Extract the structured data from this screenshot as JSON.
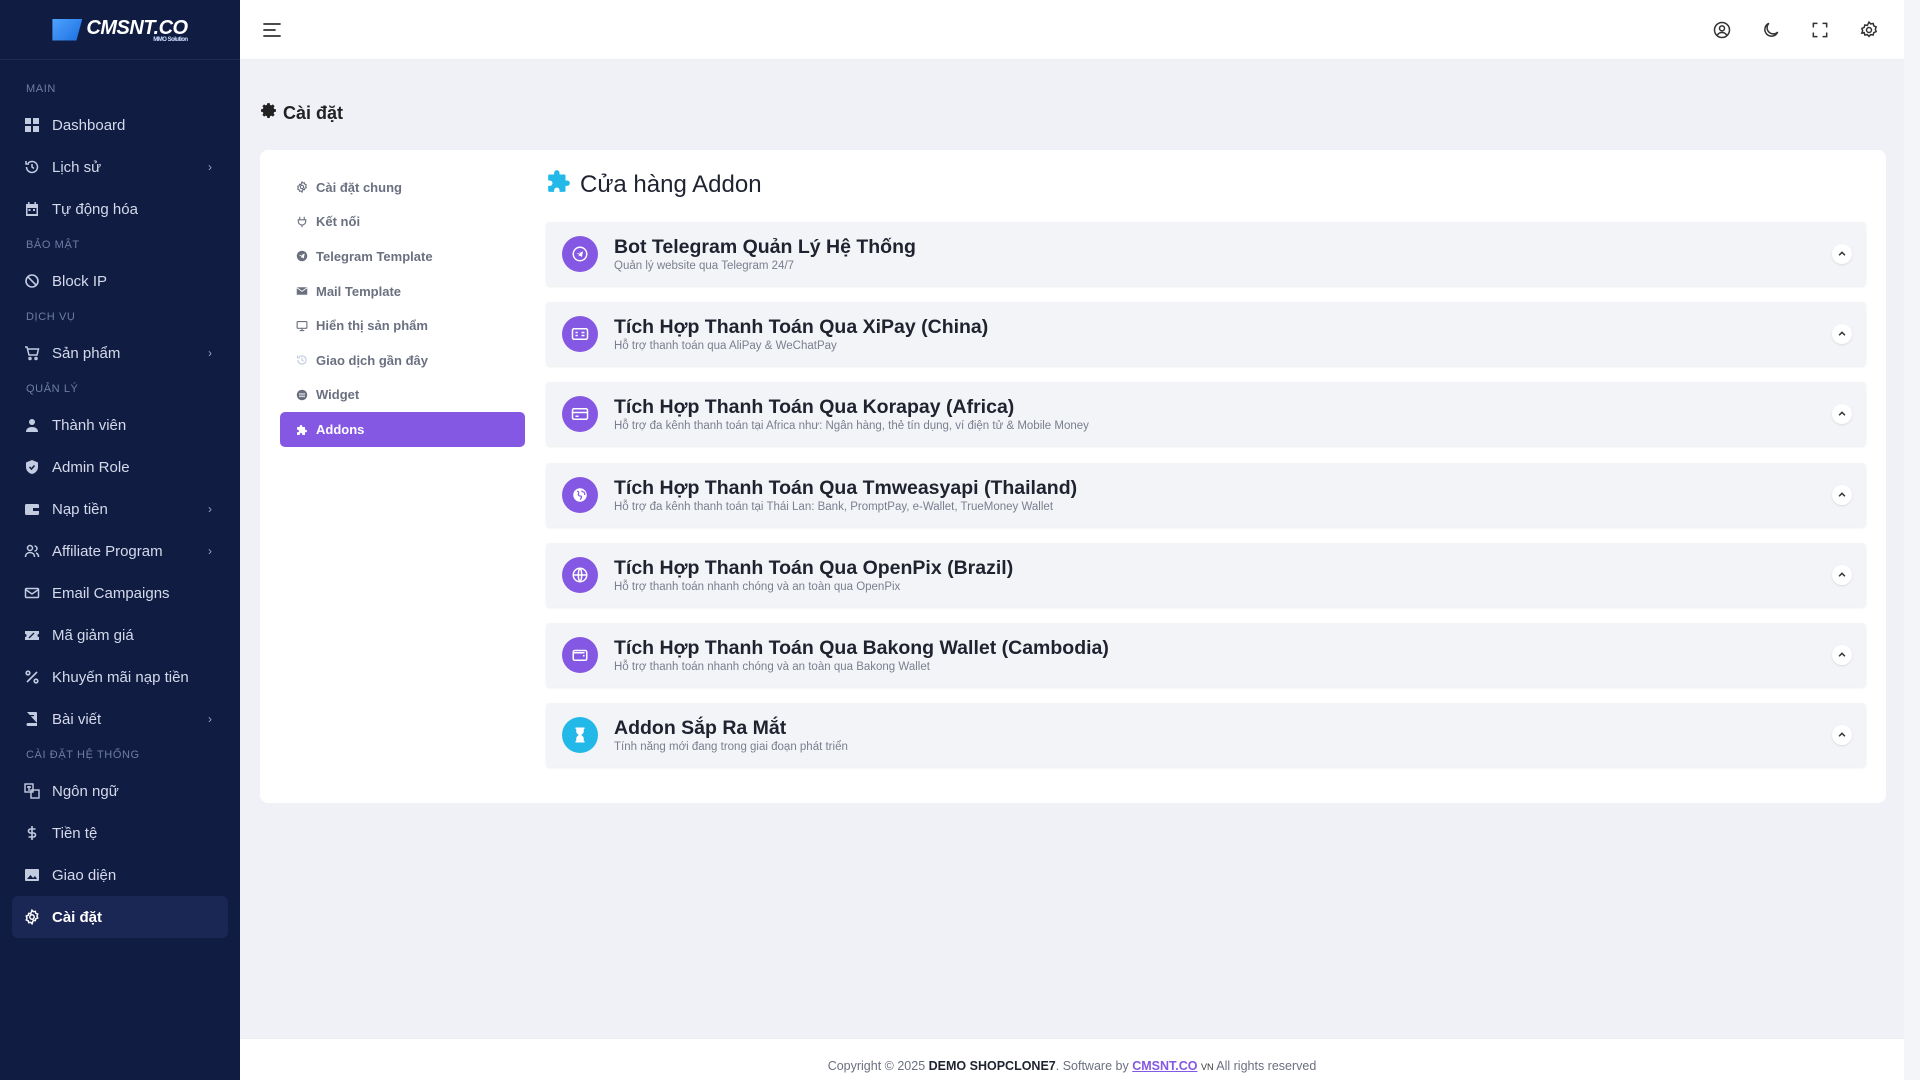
{
  "brand": {
    "name": "CMSNT.CO",
    "tagline": "MMO Solution"
  },
  "sidebar": {
    "sections": [
      {
        "title": "MAIN",
        "items": [
          {
            "label": "Dashboard",
            "icon": "grid-icon",
            "chevron": false
          },
          {
            "label": "Lịch sử",
            "icon": "history-icon",
            "chevron": true
          },
          {
            "label": "Tự động hóa",
            "icon": "calendar-icon",
            "chevron": false
          }
        ]
      },
      {
        "title": "BẢO MẬT",
        "items": [
          {
            "label": "Block IP",
            "icon": "ban-icon",
            "chevron": false
          }
        ]
      },
      {
        "title": "DỊCH VỤ",
        "items": [
          {
            "label": "Sản phẩm",
            "icon": "cart-icon",
            "chevron": true
          }
        ]
      },
      {
        "title": "QUẢN LÝ",
        "items": [
          {
            "label": "Thành viên",
            "icon": "user-icon",
            "chevron": false
          },
          {
            "label": "Admin Role",
            "icon": "shield-icon",
            "chevron": false
          },
          {
            "label": "Nạp tiền",
            "icon": "wallet-icon",
            "chevron": true
          },
          {
            "label": "Affiliate Program",
            "icon": "users-icon",
            "chevron": true
          },
          {
            "label": "Email Campaigns",
            "icon": "mail-icon",
            "chevron": false
          },
          {
            "label": "Mã giảm giá",
            "icon": "ticket-icon",
            "chevron": false
          },
          {
            "label": "Khuyến mãi nạp tiền",
            "icon": "percent-icon",
            "chevron": false
          },
          {
            "label": "Bài viết",
            "icon": "book-icon",
            "chevron": true
          }
        ]
      },
      {
        "title": "CÀI ĐẶT HỆ THỐNG",
        "items": [
          {
            "label": "Ngôn ngữ",
            "icon": "language-icon",
            "chevron": false
          },
          {
            "label": "Tiền tệ",
            "icon": "dollar-icon",
            "chevron": false
          },
          {
            "label": "Giao diện",
            "icon": "image-icon",
            "chevron": false
          },
          {
            "label": "Cài đặt",
            "icon": "gear-icon",
            "chevron": false,
            "active": true
          }
        ]
      }
    ]
  },
  "page": {
    "title": "Cài đặt"
  },
  "subnav": [
    {
      "label": "Cài đặt chung",
      "icon": "gear-icon"
    },
    {
      "label": "Kết nối",
      "icon": "plug-icon"
    },
    {
      "label": "Telegram Template",
      "icon": "telegram-icon"
    },
    {
      "label": "Mail Template",
      "icon": "envelope-icon"
    },
    {
      "label": "Hiển thị sản phẩm",
      "icon": "monitor-icon"
    },
    {
      "label": "Giao dịch gần đây",
      "icon": "history-icon"
    },
    {
      "label": "Widget",
      "icon": "widget-icon"
    },
    {
      "label": "Addons",
      "icon": "puzzle-icon",
      "active": true
    }
  ],
  "addons": {
    "heading": "Cửa hàng Addon",
    "items": [
      {
        "title": "Bot Telegram Quản Lý Hệ Thống",
        "desc": "Quản lý website qua Telegram 24/7",
        "icon": "telegram-icon"
      },
      {
        "title": "Tích Hợp Thanh Toán Qua XiPay (China)",
        "desc": "Hỗ trợ thanh toán qua AliPay & WeChatPay",
        "icon": "money-icon"
      },
      {
        "title": "Tích Hợp Thanh Toán Qua Korapay (Africa)",
        "desc": "Hỗ trợ đa kênh thanh toán tại Africa như: Ngân hàng, thẻ tín dụng, ví điện tử & Mobile Money",
        "icon": "card-icon"
      },
      {
        "title": "Tích Hợp Thanh Toán Qua Tmweasyapi (Thailand)",
        "desc": "Hỗ trợ đa kênh thanh toán tại Thái Lan: Bank, PromptPay, e-Wallet, TrueMoney Wallet",
        "icon": "globe-asia-icon"
      },
      {
        "title": "Tích Hợp Thanh Toán Qua OpenPix (Brazil)",
        "desc": "Hỗ trợ thanh toán nhanh chóng và an toàn qua OpenPix",
        "icon": "globe-icon"
      },
      {
        "title": "Tích Hợp Thanh Toán Qua Bakong Wallet (Cambodia)",
        "desc": "Hỗ trợ thanh toán nhanh chóng và an toàn qua Bakong Wallet",
        "icon": "wallet-icon"
      },
      {
        "title": "Addon Sắp Ra Mắt",
        "desc": "Tính năng mới đang trong giai đoạn phát triển",
        "icon": "hourglass-icon",
        "color": "#22b8e8"
      }
    ]
  },
  "footer": {
    "prefix": "Copyright © 2025",
    "site": "DEMO SHOPCLONE7",
    "middle": ". Software by",
    "vendor": "CMSNT.CO",
    "country": "VN",
    "suffix": "All rights reserved"
  },
  "colors": {
    "sidebar_bg": "#111c43",
    "accent": "#8458e3",
    "teal": "#22b8e8",
    "page_bg": "#f0f1f7"
  }
}
